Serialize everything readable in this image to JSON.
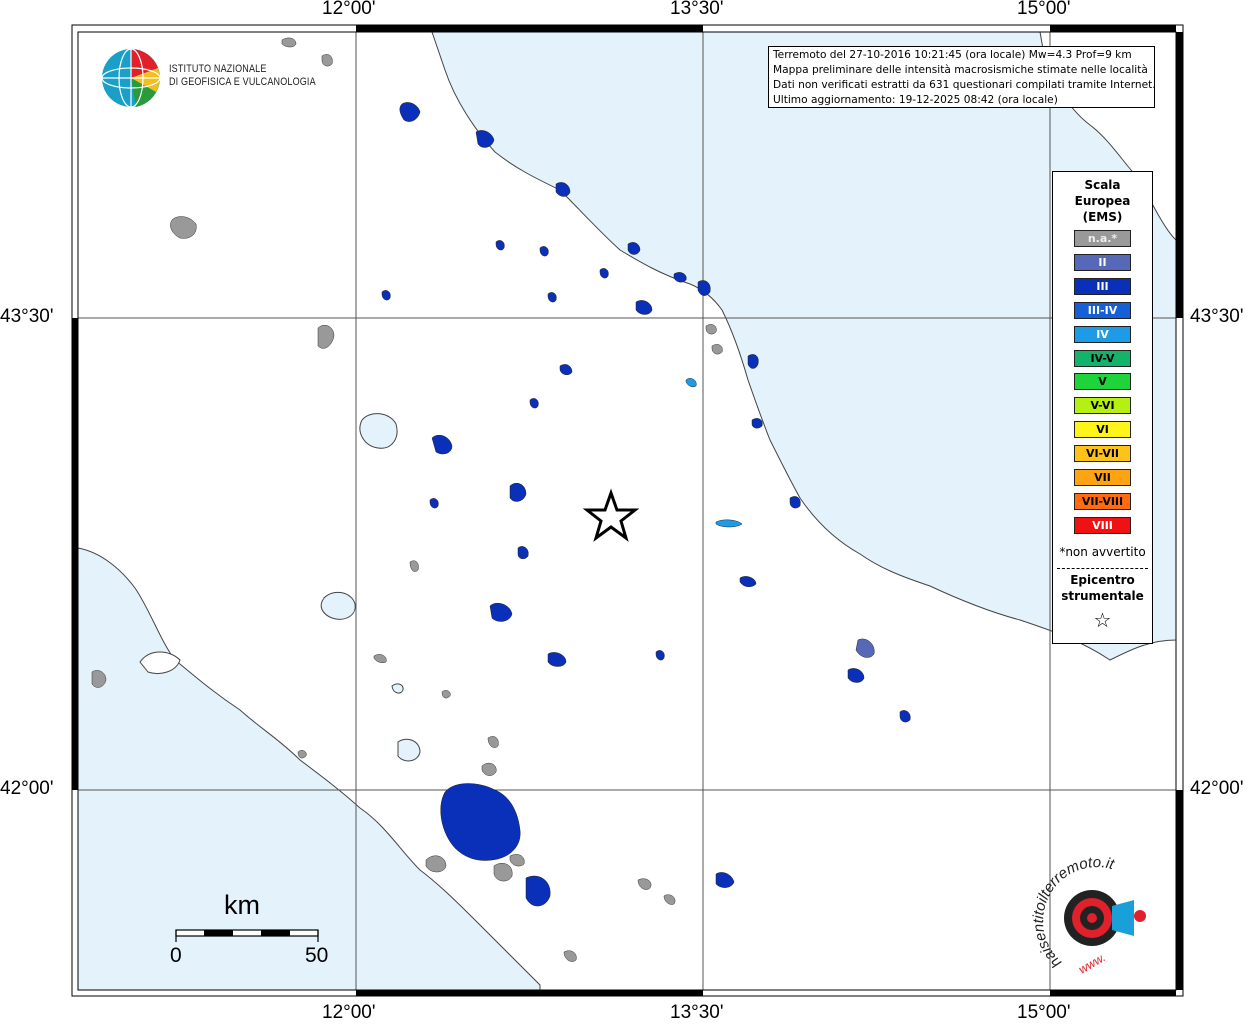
{
  "coords": {
    "lon_labels": [
      "12°00'",
      "13°30'",
      "15°00'"
    ],
    "lat_labels": [
      "43°30'",
      "42°00'"
    ]
  },
  "institute": {
    "name_line1": "ISTITUTO NAZIONALE",
    "name_line2": "DI GEOFISICA E VULCANOLOGIA"
  },
  "info": {
    "line1": "Terremoto del 27-10-2016 10:21:45 (ora locale) Mw=4.3 Prof=9 km",
    "line2": "Mappa preliminare delle intensità macrosismiche stimate nelle località",
    "line3": "Dati non verificati estratti da 631 questionari compilati tramite Internet.",
    "line4": "Ultimo aggiornamento: 19-12-2025 08:42 (ora locale)"
  },
  "legend": {
    "title_line1": "Scala",
    "title_line2": "Europea",
    "title_line3": "(EMS)",
    "items": [
      {
        "label": "n.a.*",
        "color": "#999999"
      },
      {
        "label": "II",
        "color": "#5669b8"
      },
      {
        "label": "III",
        "color": "#0a2fb8"
      },
      {
        "label": "III-IV",
        "color": "#1560d6"
      },
      {
        "label": "IV",
        "color": "#1e9be6"
      },
      {
        "label": "IV-V",
        "color": "#14b36b"
      },
      {
        "label": "V",
        "color": "#1fd43a"
      },
      {
        "label": "V-VI",
        "color": "#b4f012"
      },
      {
        "label": "VI",
        "color": "#fff41a"
      },
      {
        "label": "VI-VII",
        "color": "#ffc21a"
      },
      {
        "label": "VII",
        "color": "#ffa312"
      },
      {
        "label": "VII-VIII",
        "color": "#ff6a12"
      },
      {
        "label": "VIII",
        "color": "#f01212"
      }
    ],
    "note": "*non avvertito",
    "epicenter_line1": "Epicentro",
    "epicenter_line2": "strumentale",
    "star": "☆"
  },
  "scale_bar": {
    "unit": "km",
    "start": "0",
    "end": "50"
  },
  "colors": {
    "sea": "#e3f2fb",
    "land": "#ffffff",
    "coast": "#444444",
    "intensity_III": "#0a2fb8",
    "intensity_na": "#999999"
  },
  "icons": {
    "epicenter": "star-icon",
    "institute_logo": "globe-logo-icon",
    "website_logo": "hsit-logo-icon"
  },
  "website_logo": {
    "text": "haisentitoilterremoto.it",
    "www": "www."
  }
}
